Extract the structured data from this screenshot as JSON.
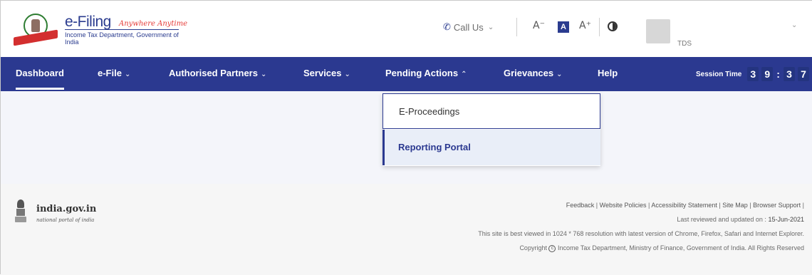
{
  "header": {
    "logo_title": "e-Filing",
    "logo_tagline": "Anywhere Anytime",
    "logo_subtitle": "Income Tax Department, Government of India",
    "call_us": "Call Us",
    "font_decrease": "A⁻",
    "font_normal": "A",
    "font_increase": "A⁺",
    "user_name": "TDS"
  },
  "nav": {
    "items": [
      {
        "label": "Dashboard",
        "caret": ""
      },
      {
        "label": "e-File",
        "caret": "⌄"
      },
      {
        "label": "Authorised Partners",
        "caret": "⌄"
      },
      {
        "label": "Services",
        "caret": "⌄"
      },
      {
        "label": "Pending Actions",
        "caret": "⌃"
      },
      {
        "label": "Grievances",
        "caret": "⌄"
      },
      {
        "label": "Help",
        "caret": ""
      }
    ],
    "session_label": "Session Time",
    "session_digits": [
      "3",
      "9",
      "3",
      "7"
    ]
  },
  "dropdown": {
    "items": [
      "E-Proceedings",
      "Reporting Portal"
    ]
  },
  "footer": {
    "india_title": "india.gov.in",
    "india_subtitle": "national portal of india",
    "links": [
      "Feedback",
      "Website Policies",
      "Accessibility Statement",
      "Site Map",
      "Browser Support"
    ],
    "last_reviewed_label": "Last reviewed and updated on :",
    "last_reviewed_date": "15-Jun-2021",
    "best_viewed": "This site is best viewed in 1024 * 768 resolution with latest version of Chrome, Firefox, Safari and Internet Explorer.",
    "copyright": "Copyright",
    "copyright_rest": "Income Tax Department, Ministry of Finance, Government of India. All Rights Reserved"
  },
  "colors": {
    "nav_bg": "#2b3990",
    "accent_red": "#e53935"
  }
}
